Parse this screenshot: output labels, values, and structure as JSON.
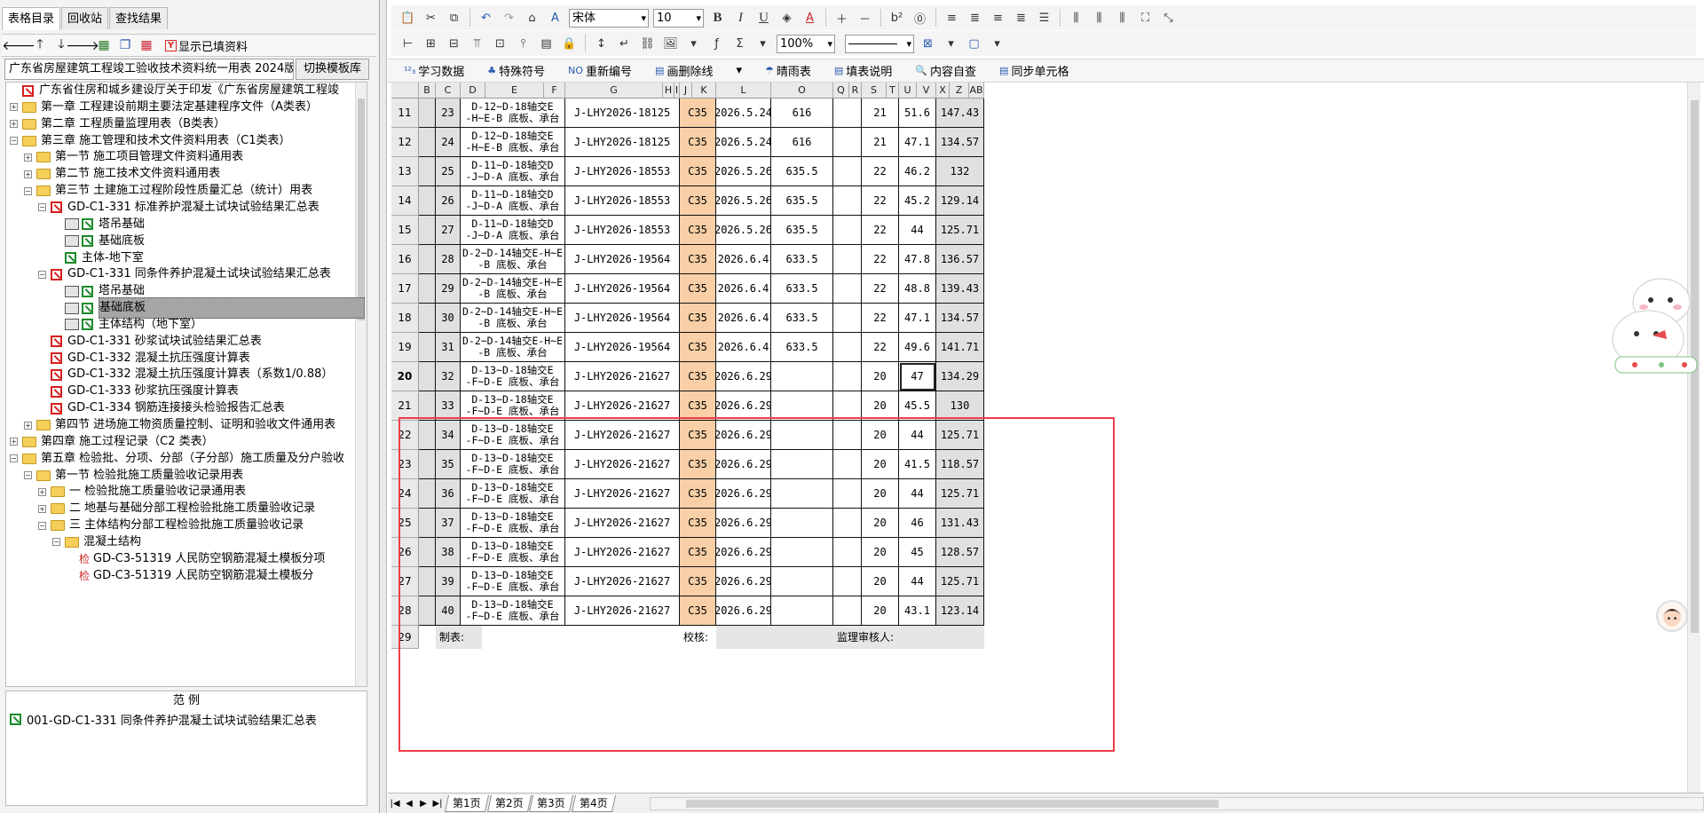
{
  "left_panel": {
    "tabs": [
      "表格目录",
      "回收站",
      "查找结果"
    ],
    "toolbar": {
      "show_filled_label": "显示已填资料"
    },
    "template_select": {
      "value": "广东省房屋建筑工程竣工验收技术资料统一用表 2024版",
      "switch_button": "切换模板库"
    },
    "tree": [
      {
        "label": "广东省住房和城乡建设厅关于印发《广东省房屋建筑工程竣",
        "icon": "xred",
        "level": 1,
        "pm": ""
      },
      {
        "label": "第一章 工程建设前期主要法定基建程序文件（A类表）",
        "icon": "folder",
        "level": 1,
        "pm": "+"
      },
      {
        "label": "第二章 工程质量监理用表（B类表）",
        "icon": "folder",
        "level": 1,
        "pm": "+"
      },
      {
        "label": "第三章 施工管理和技术文件资料用表（C1类表）",
        "icon": "folder",
        "level": 1,
        "pm": "-"
      },
      {
        "label": "第一节 施工项目管理文件资料通用表",
        "icon": "folder",
        "level": 2,
        "pm": "+"
      },
      {
        "label": "第二节 施工技术文件资料通用表",
        "icon": "folder",
        "level": 2,
        "pm": "+"
      },
      {
        "label": "第三节 土建施工过程阶段性质量汇总（统计）用表",
        "icon": "folder",
        "level": 2,
        "pm": "-"
      },
      {
        "label": "GD-C1-331 标准养护混凝土试块试验结果汇总表",
        "icon": "xred",
        "level": 3,
        "pm": "-"
      },
      {
        "label": "塔吊基础",
        "icon": "print-green",
        "level": 4,
        "pm": ""
      },
      {
        "label": "基础底板",
        "icon": "print-green",
        "level": 4,
        "pm": ""
      },
      {
        "label": "主体-地下室",
        "icon": "green",
        "level": 4,
        "pm": ""
      },
      {
        "label": "GD-C1-331 同条件养护混凝土试块试验结果汇总表",
        "icon": "xred",
        "level": 3,
        "pm": "-"
      },
      {
        "label": "塔吊基础",
        "icon": "print-green",
        "level": 4,
        "pm": ""
      },
      {
        "label": "基础底板",
        "icon": "print-green",
        "level": 4,
        "pm": "",
        "selected": true
      },
      {
        "label": "主体结构（地下室）",
        "icon": "print-green",
        "level": 4,
        "pm": ""
      },
      {
        "label": "GD-C1-331 砂浆试块试验结果汇总表",
        "icon": "xred",
        "level": 3,
        "pm": ""
      },
      {
        "label": "GD-C1-332 混凝土抗压强度计算表",
        "icon": "xred",
        "level": 3,
        "pm": ""
      },
      {
        "label": "GD-C1-332 混凝土抗压强度计算表（系数1/0.88）",
        "icon": "xred",
        "level": 3,
        "pm": ""
      },
      {
        "label": "GD-C1-333 砂浆抗压强度计算表",
        "icon": "xred",
        "level": 3,
        "pm": ""
      },
      {
        "label": "GD-C1-334 钢筋连接接头检验报告汇总表",
        "icon": "xred",
        "level": 3,
        "pm": ""
      },
      {
        "label": "第四节 进场施工物资质量控制、证明和验收文件通用表",
        "icon": "folder",
        "level": 2,
        "pm": "+"
      },
      {
        "label": "第四章 施工过程记录（C2 类表）",
        "icon": "folder",
        "level": 1,
        "pm": "+"
      },
      {
        "label": "第五章 检验批、分项、分部（子分部）施工质量及分户验收",
        "icon": "folder",
        "level": 1,
        "pm": "-"
      },
      {
        "label": "第一节 检验批施工质量验收记录用表",
        "icon": "folder",
        "level": 2,
        "pm": "-"
      },
      {
        "label": "一 检验批施工质量验收记录通用表",
        "icon": "folder",
        "level": 3,
        "pm": "+"
      },
      {
        "label": "二 地基与基础分部工程检验批施工质量验收记录",
        "icon": "folder",
        "level": 3,
        "pm": "+"
      },
      {
        "label": "三 主体结构分部工程检验批施工质量验收记录",
        "icon": "folder",
        "level": 3,
        "pm": "-"
      },
      {
        "label": "混凝土结构",
        "icon": "folder",
        "level": 4,
        "pm": "-"
      },
      {
        "label": "GD-C3-51319 人民防空钢筋混凝土模板分项",
        "icon": "check",
        "level": 5,
        "pm": ""
      },
      {
        "label": "GD-C3-51319 人民防空钢筋混凝土模板分",
        "icon": "check",
        "level": 5,
        "pm": ""
      }
    ],
    "example": {
      "title": "范      例",
      "item": "001-GD-C1-331 同条件养护混凝土试块试验结果汇总表"
    }
  },
  "toolbar": {
    "font_name": "宋体",
    "font_size": "10",
    "zoom": "100%",
    "row3": [
      {
        "icon": "study-icon",
        "label": "学习数据"
      },
      {
        "icon": "special-symbol-icon",
        "label": "特殊符号"
      },
      {
        "icon": "renumber-icon",
        "label": "重新编号"
      },
      {
        "icon": "strikethrough-icon",
        "label": "画删除线"
      },
      {
        "icon": "weather-icon",
        "label": "晴雨表"
      },
      {
        "icon": "fill-guide-icon",
        "label": "填表说明"
      },
      {
        "icon": "content-check-icon",
        "label": "内容自查"
      },
      {
        "icon": "sync-cell-icon",
        "label": "同步单元格"
      }
    ]
  },
  "grid": {
    "columns": [
      "B",
      "C",
      "D",
      "E",
      "F",
      "G",
      "H",
      "I",
      "J",
      "K",
      "L",
      "O",
      "Q",
      "R",
      "S",
      "T",
      "U",
      "V",
      "X",
      "Z",
      "AB"
    ],
    "rows": [
      {
        "row": "11",
        "no": "23",
        "desc": "D-12~D-18轴交E\n-H~E-B 底板、承台",
        "report": "J-LHY2026-18125",
        "grade": "C35",
        "date": "2026.5.24",
        "o": "616",
        "s": "21",
        "u": "51.6",
        "x": "147.43"
      },
      {
        "row": "12",
        "no": "24",
        "desc": "D-12~D-18轴交E\n-H~E-B 底板、承台",
        "report": "J-LHY2026-18125",
        "grade": "C35",
        "date": "2026.5.24",
        "o": "616",
        "s": "21",
        "u": "47.1",
        "x": "134.57"
      },
      {
        "row": "13",
        "no": "25",
        "desc": "D-11~D-18轴交D\n-J~D-A 底板、承台",
        "report": "J-LHY2026-18553",
        "grade": "C35",
        "date": "2026.5.26",
        "o": "635.5",
        "s": "22",
        "u": "46.2",
        "x": "132"
      },
      {
        "row": "14",
        "no": "26",
        "desc": "D-11~D-18轴交D\n-J~D-A 底板、承台",
        "report": "J-LHY2026-18553",
        "grade": "C35",
        "date": "2026.5.26",
        "o": "635.5",
        "s": "22",
        "u": "45.2",
        "x": "129.14"
      },
      {
        "row": "15",
        "no": "27",
        "desc": "D-11~D-18轴交D\n-J~D-A 底板、承台",
        "report": "J-LHY2026-18553",
        "grade": "C35",
        "date": "2026.5.26",
        "o": "635.5",
        "s": "22",
        "u": "44",
        "x": "125.71"
      },
      {
        "row": "16",
        "no": "28",
        "desc": "D-2~D-14轴交E-H~E\n-B 底板、承台",
        "report": "J-LHY2026-19564",
        "grade": "C35",
        "date": "2026.6.4",
        "o": "633.5",
        "s": "22",
        "u": "47.8",
        "x": "136.57"
      },
      {
        "row": "17",
        "no": "29",
        "desc": "D-2~D-14轴交E-H~E\n-B 底板、承台",
        "report": "J-LHY2026-19564",
        "grade": "C35",
        "date": "2026.6.4",
        "o": "633.5",
        "s": "22",
        "u": "48.8",
        "x": "139.43"
      },
      {
        "row": "18",
        "no": "30",
        "desc": "D-2~D-14轴交E-H~E\n-B 底板、承台",
        "report": "J-LHY2026-19564",
        "grade": "C35",
        "date": "2026.6.4",
        "o": "633.5",
        "s": "22",
        "u": "47.1",
        "x": "134.57"
      },
      {
        "row": "19",
        "no": "31",
        "desc": "D-2~D-14轴交E-H~E\n-B 底板、承台",
        "report": "J-LHY2026-19564",
        "grade": "C35",
        "date": "2026.6.4",
        "o": "633.5",
        "s": "22",
        "u": "49.6",
        "x": "141.71"
      },
      {
        "row": "20",
        "no": "32",
        "desc": "D-13~D-18轴交E\n-F~D-E 底板、承台",
        "report": "J-LHY2026-21627",
        "grade": "C35",
        "date": "2026.6.29",
        "o": "",
        "s": "20",
        "u": "47",
        "x": "134.29",
        "active": true
      },
      {
        "row": "21",
        "no": "33",
        "desc": "D-13~D-18轴交E\n-F~D-E 底板、承台",
        "report": "J-LHY2026-21627",
        "grade": "C35",
        "date": "2026.6.29",
        "o": "",
        "s": "20",
        "u": "45.5",
        "x": "130"
      },
      {
        "row": "22",
        "no": "34",
        "desc": "D-13~D-18轴交E\n-F~D-E 底板、承台",
        "report": "J-LHY2026-21627",
        "grade": "C35",
        "date": "2026.6.29",
        "o": "",
        "s": "20",
        "u": "44",
        "x": "125.71"
      },
      {
        "row": "23",
        "no": "35",
        "desc": "D-13~D-18轴交E\n-F~D-E 底板、承台",
        "report": "J-LHY2026-21627",
        "grade": "C35",
        "date": "2026.6.29",
        "o": "",
        "s": "20",
        "u": "41.5",
        "x": "118.57"
      },
      {
        "row": "24",
        "no": "36",
        "desc": "D-13~D-18轴交E\n-F~D-E 底板、承台",
        "report": "J-LHY2026-21627",
        "grade": "C35",
        "date": "2026.6.29",
        "o": "",
        "s": "20",
        "u": "44",
        "x": "125.71"
      },
      {
        "row": "25",
        "no": "37",
        "desc": "D-13~D-18轴交E\n-F~D-E 底板、承台",
        "report": "J-LHY2026-21627",
        "grade": "C35",
        "date": "2026.6.29",
        "o": "",
        "s": "20",
        "u": "46",
        "x": "131.43"
      },
      {
        "row": "26",
        "no": "38",
        "desc": "D-13~D-18轴交E\n-F~D-E 底板、承台",
        "report": "J-LHY2026-21627",
        "grade": "C35",
        "date": "2026.6.29",
        "o": "",
        "s": "20",
        "u": "45",
        "x": "128.57"
      },
      {
        "row": "27",
        "no": "39",
        "desc": "D-13~D-18轴交E\n-F~D-E 底板、承台",
        "report": "J-LHY2026-21627",
        "grade": "C35",
        "date": "2026.6.29",
        "o": "",
        "s": "20",
        "u": "44",
        "x": "125.71"
      },
      {
        "row": "28",
        "no": "40",
        "desc": "D-13~D-18轴交E\n-F~D-E 底板、承台",
        "report": "J-LHY2026-21627",
        "grade": "C35",
        "date": "2026.6.29",
        "o": "",
        "s": "20",
        "u": "43.1",
        "x": "123.14"
      }
    ],
    "footer": {
      "row": "29",
      "maker": "制表:",
      "checker": "校核:",
      "supervisor": "监理审核人:"
    }
  },
  "sheet_tabs": [
    "第1页",
    "第2页",
    "第3页",
    "第4页"
  ],
  "colors": {
    "highlight_frame": "#f03d4a",
    "grade_fill": "#f8cfa6",
    "gray_fill": "#e0e0e0"
  }
}
